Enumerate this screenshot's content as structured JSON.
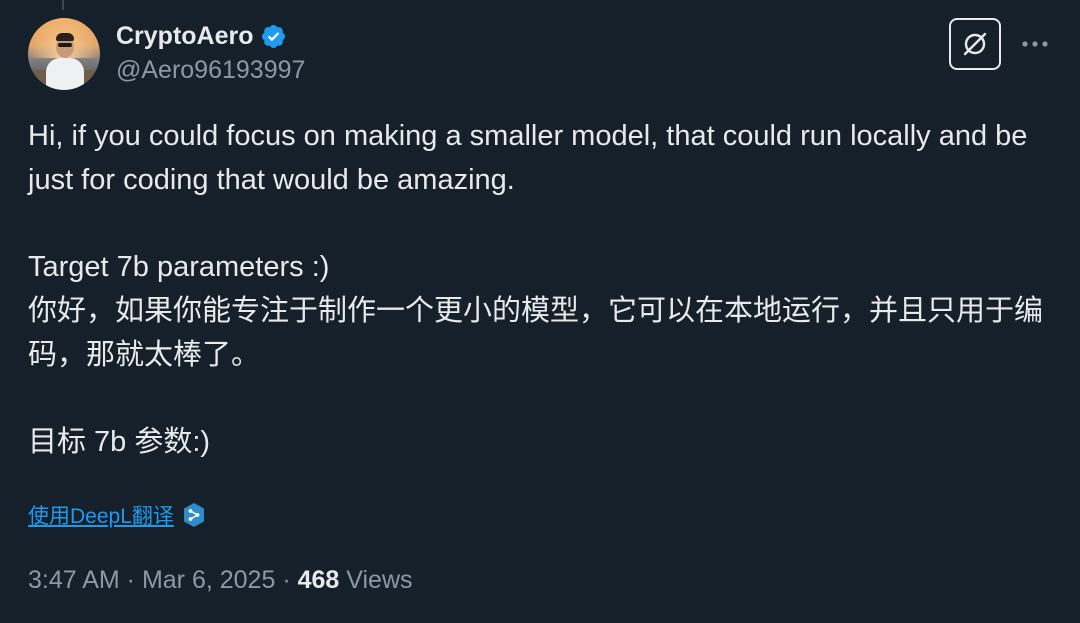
{
  "user": {
    "display_name": "CryptoAero",
    "handle": "@Aero96193997",
    "verified": true,
    "avatar_icon": "profile-photo"
  },
  "controls": {
    "grok_icon": "grok-icon",
    "more_icon": "more-options-icon"
  },
  "tweet": {
    "paragraphs": [
      "Hi, if you could focus on making a smaller model, that could run locally and be just for coding that would be amazing.",
      "Target 7b parameters :)",
      "你好，如果你能专注于制作一个更小的模型，它可以在本地运行，并且只用于编码，那就太棒了。",
      "目标 7b 参数:)"
    ]
  },
  "translate": {
    "label": "使用DeepL翻译",
    "icon": "deepl-icon"
  },
  "meta": {
    "time": "3:47 AM",
    "separator1": " · ",
    "date": "Mar 6, 2025",
    "separator2": " · ",
    "views_count": "468",
    "views_label": " Views"
  },
  "colors": {
    "background": "#15202b",
    "text": "#e7e9ea",
    "secondary_text": "#8b98a5",
    "link": "#1d9bf0",
    "verified_badge": "#1d9bf0"
  }
}
